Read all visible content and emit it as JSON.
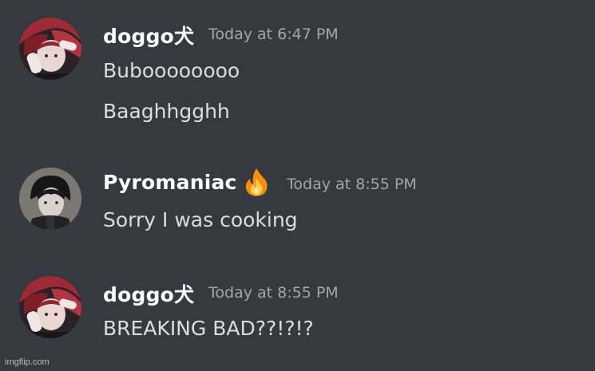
{
  "messages": [
    {
      "username": "doggo犬",
      "timestamp": "Today at 6:47 PM",
      "lines": [
        "Buboooooooo",
        "Baaghhgghh"
      ],
      "avatar_icon": "anime-avatar-red-hair"
    },
    {
      "username": "Pyromaniac",
      "username_emoji": "fire-icon",
      "timestamp": "Today at 8:55 PM",
      "lines": [
        "Sorry I was cooking"
      ],
      "avatar_icon": "anime-avatar-dark-hair"
    },
    {
      "username": "doggo犬",
      "timestamp": "Today at 8:55 PM",
      "lines": [
        "BREAKING BAD??!?!?"
      ],
      "avatar_icon": "anime-avatar-red-hair"
    }
  ],
  "watermark": "imgflip.com",
  "colors": {
    "background": "#36393f",
    "username": "#ffffff",
    "timestamp": "#a3a6aa",
    "text": "#dcddde"
  }
}
